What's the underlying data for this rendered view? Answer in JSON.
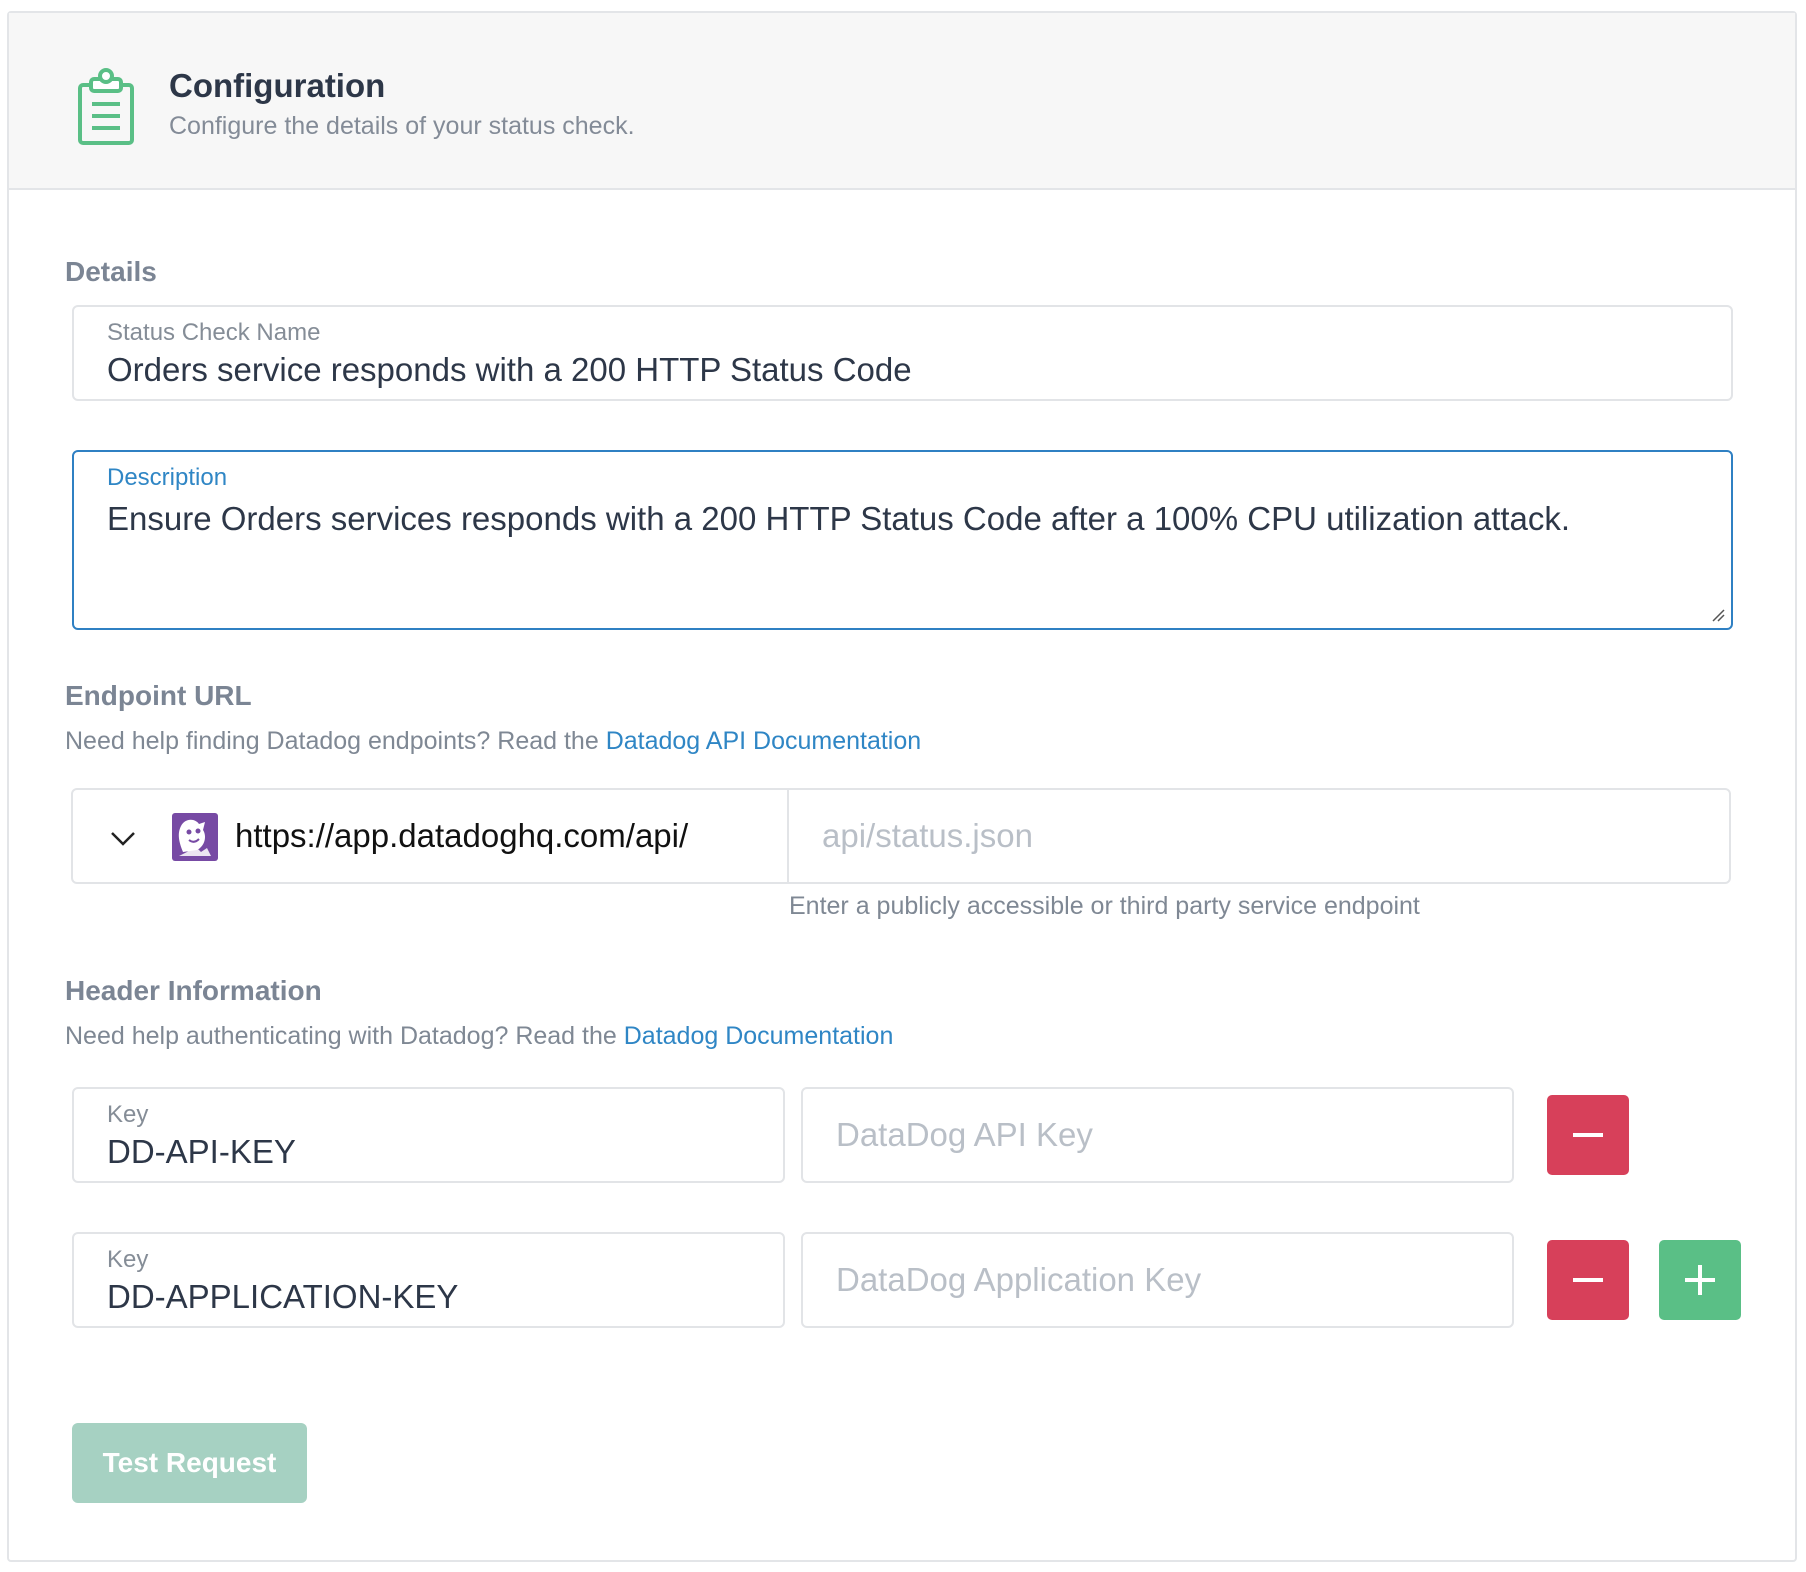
{
  "header": {
    "icon": "clipboard-icon",
    "title": "Configuration",
    "subtitle": "Configure the details of your status check."
  },
  "details": {
    "section_label": "Details",
    "name_field": {
      "label": "Status Check Name",
      "value": "Orders service responds with a 200 HTTP Status Code"
    },
    "description_field": {
      "label": "Description",
      "value": "Ensure Orders services responds with a 200 HTTP Status Code after a 100% CPU utilization attack."
    }
  },
  "endpoint": {
    "section_label": "Endpoint URL",
    "help_prefix": "Need help finding Datadog endpoints? Read the ",
    "help_link": "Datadog API Documentation",
    "base_url": "https://app.datadoghq.com/api/",
    "base_icon": "datadog-logo-icon",
    "path_placeholder": "api/status.json",
    "hint": "Enter a publicly accessible or third party service endpoint"
  },
  "headers": {
    "section_label": "Header Information",
    "help_prefix": "Need help authenticating with Datadog? Read the ",
    "help_link": "Datadog Documentation",
    "rows": [
      {
        "key_label": "Key",
        "key_value": "DD-API-KEY",
        "value_placeholder": "DataDog API Key"
      },
      {
        "key_label": "Key",
        "key_value": "DD-APPLICATION-KEY",
        "value_placeholder": "DataDog Application Key"
      }
    ]
  },
  "actions": {
    "test_label": "Test Request"
  },
  "colors": {
    "accent": "#2f86c5",
    "remove": "#d7405a",
    "add": "#5abf86",
    "test_button": "#a6d1c2",
    "icon_green": "#5abf86"
  }
}
